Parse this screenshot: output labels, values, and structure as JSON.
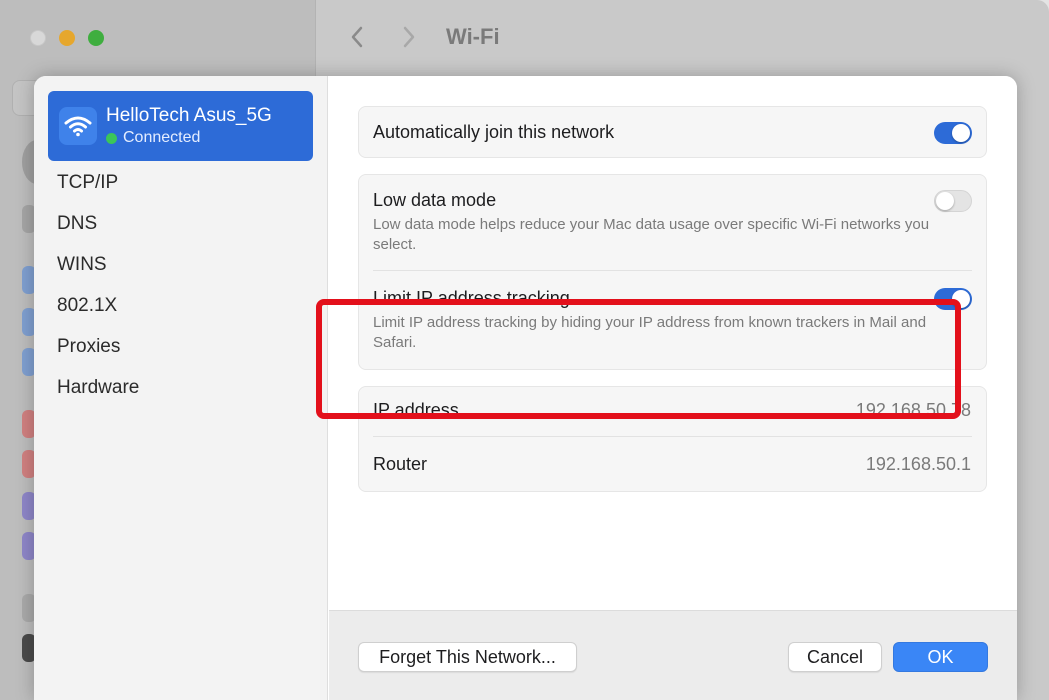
{
  "window": {
    "title": "Wi-Fi",
    "back_icon": "chevron-left-icon",
    "forward_icon": "chevron-right-icon"
  },
  "sidebar": {
    "network": {
      "name": "HelloTech Asus_5G",
      "status": "Connected",
      "icon": "wifi-icon",
      "status_color": "#3bc659"
    },
    "items": [
      {
        "label": "TCP/IP"
      },
      {
        "label": "DNS"
      },
      {
        "label": "WINS"
      },
      {
        "label": "802.1X"
      },
      {
        "label": "Proxies"
      },
      {
        "label": "Hardware"
      }
    ]
  },
  "settings": {
    "auto_join": {
      "label": "Automatically join this network",
      "enabled": true
    },
    "low_data": {
      "label": "Low data mode",
      "description": "Low data mode helps reduce your Mac data usage over specific Wi-Fi networks you select.",
      "enabled": false
    },
    "limit_ip": {
      "label": "Limit IP address tracking",
      "description": "Limit IP address tracking by hiding your IP address from known trackers in Mail and Safari.",
      "enabled": true
    },
    "ip_address": {
      "label": "IP address",
      "value": "192.168.50.78"
    },
    "router": {
      "label": "Router",
      "value": "192.168.50.1"
    }
  },
  "footer": {
    "forget_label": "Forget This Network...",
    "cancel_label": "Cancel",
    "ok_label": "OK"
  },
  "colors": {
    "accent": "#2d6bd7",
    "highlight": "#e3101b",
    "ok_button": "#3a86f6"
  }
}
